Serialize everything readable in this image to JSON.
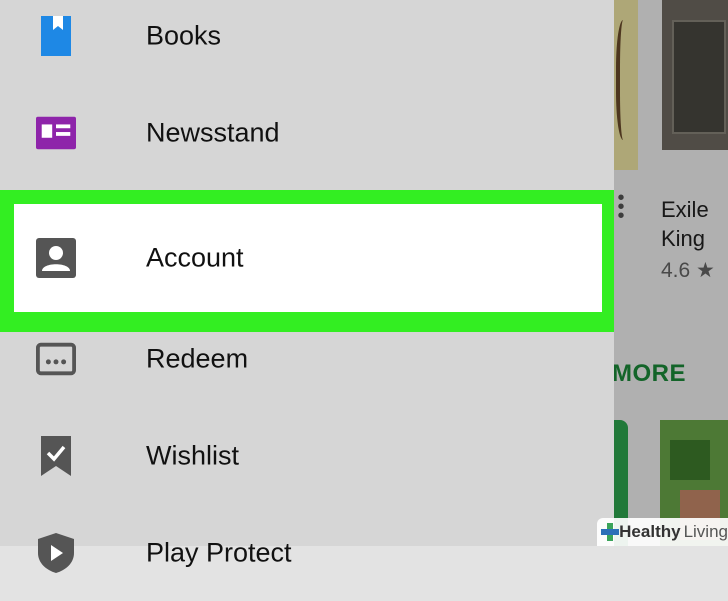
{
  "background": {
    "card_title": "Exile\nKing",
    "card_rating": "4.6 ★",
    "more_label": "MORE"
  },
  "drawer": {
    "items": [
      {
        "label": "Books",
        "icon": "book-icon"
      },
      {
        "label": "Newsstand",
        "icon": "newsstand-icon"
      },
      {
        "label": "Account",
        "icon": "account-icon",
        "highlighted": true
      },
      {
        "label": "Redeem",
        "icon": "redeem-icon"
      },
      {
        "label": "Wishlist",
        "icon": "wishlist-icon"
      },
      {
        "label": "Play Protect",
        "icon": "play-protect-icon"
      }
    ]
  },
  "watermark": {
    "brand_bold": "Healthy",
    "brand_light": "Living"
  },
  "colors": {
    "highlight": "#33ee22",
    "books_icon": "#1e88e5",
    "newsstand_icon": "#8e24aa",
    "icon_gray": "#555555",
    "more_link": "#1b8b3a"
  }
}
